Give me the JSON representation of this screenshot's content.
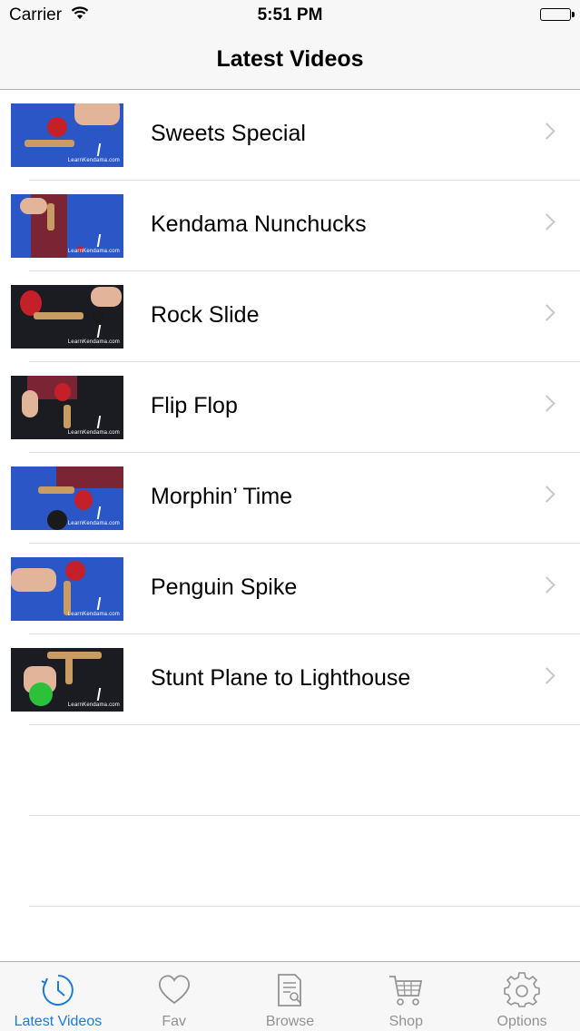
{
  "status": {
    "carrier": "Carrier",
    "time": "5:51 PM"
  },
  "nav": {
    "title": "Latest Videos"
  },
  "videos": [
    {
      "title": "Sweets Special",
      "thumb_logo": "LearnKendama.com"
    },
    {
      "title": "Kendama Nunchucks",
      "thumb_logo": "LearnKendama.com"
    },
    {
      "title": "Rock Slide",
      "thumb_logo": "LearnKendama.com"
    },
    {
      "title": "Flip Flop",
      "thumb_logo": "LearnKendama.com"
    },
    {
      "title": "Morphin’ Time",
      "thumb_logo": "LearnKendama.com"
    },
    {
      "title": "Penguin Spike",
      "thumb_logo": "LearnKendama.com"
    },
    {
      "title": "Stunt Plane to Lighthouse",
      "thumb_logo": "LearnKendama.com"
    }
  ],
  "tabs": [
    {
      "label": "Latest Videos",
      "icon": "clock-icon",
      "active": true
    },
    {
      "label": "Fav",
      "icon": "heart-icon",
      "active": false
    },
    {
      "label": "Browse",
      "icon": "document-search-icon",
      "active": false
    },
    {
      "label": "Shop",
      "icon": "cart-icon",
      "active": false
    },
    {
      "label": "Options",
      "icon": "gear-icon",
      "active": false
    }
  ],
  "colors": {
    "accent": "#1d7ad7",
    "inactive": "#929292",
    "bar_bg": "#f7f7f7",
    "chevron": "#c7c7cc"
  }
}
